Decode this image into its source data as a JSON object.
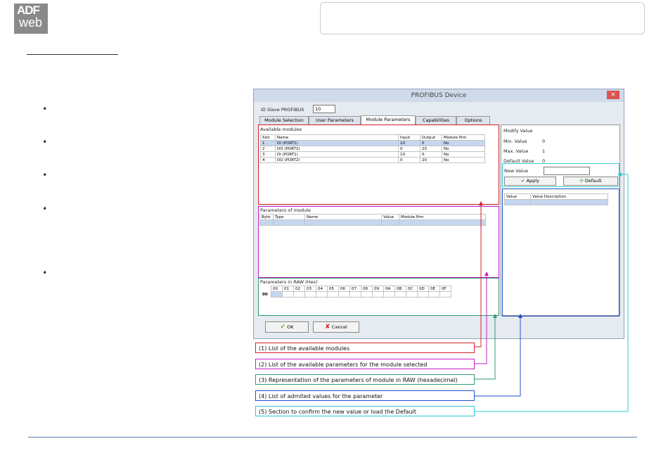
{
  "logo": {
    "line1": "ADF",
    "line2": "web"
  },
  "bullets": [
    "",
    "",
    "",
    "",
    ""
  ],
  "window": {
    "title": "PROFIBUS Device",
    "close": "×",
    "id_label": "ID Slave PROFIBUS",
    "id_value": "10",
    "tabs": [
      "Module Selection",
      "User Parameters",
      "Module Parameters",
      "Capabilities",
      "Options"
    ],
    "available": {
      "title": "Available modules",
      "headers": [
        "Slot",
        "Name",
        "Input",
        "Output",
        "Module Prm"
      ],
      "rows": [
        [
          "1",
          "DI (PORT1)",
          "10",
          "0",
          "No"
        ],
        [
          "2",
          "DO (PORT2)",
          "0",
          "20",
          "No"
        ],
        [
          "3",
          "DI (PORT1)",
          "10",
          "0",
          "No"
        ],
        [
          "4",
          "DO (PORT2)",
          "0",
          "20",
          "No"
        ]
      ]
    },
    "params": {
      "title": "Parameters of module",
      "headers": [
        "Byte",
        "Type",
        "Name",
        "Value",
        "Module Prm"
      ]
    },
    "raw": {
      "title": "Parameters in RAW (Hex)",
      "cols": [
        "00",
        "01",
        "02",
        "03",
        "04",
        "05",
        "06",
        "07",
        "08",
        "09",
        "0A",
        "0B",
        "0C",
        "0D",
        "0E",
        "0F"
      ],
      "row_label": "00"
    },
    "modify": {
      "title": "Modify Value",
      "min_label": "Min. Value",
      "min": "0",
      "max_label": "Max. Value",
      "max": "1",
      "def_label": "Default Value",
      "def": "0",
      "new_label": "New Value",
      "apply": "Apply",
      "default": "Default"
    },
    "values": {
      "headers": [
        "Value",
        "Value Description"
      ]
    },
    "ok": "OK",
    "cancel": "Cancel"
  },
  "callouts": [
    {
      "text": "(1) List of the available modules",
      "color": "#d0202a"
    },
    {
      "text": "(2) List of the available parameters for the module selected",
      "color": "#c020c0"
    },
    {
      "text": "(3) Representation of the parameters of module in RAW (hexadecimal)",
      "color": "#2f9a7a"
    },
    {
      "text": "(4) List of admited values for the parameter",
      "color": "#2050c8"
    },
    {
      "text": "(5) Section to confirm the new value or load the Default",
      "color": "#30c8d0"
    }
  ]
}
